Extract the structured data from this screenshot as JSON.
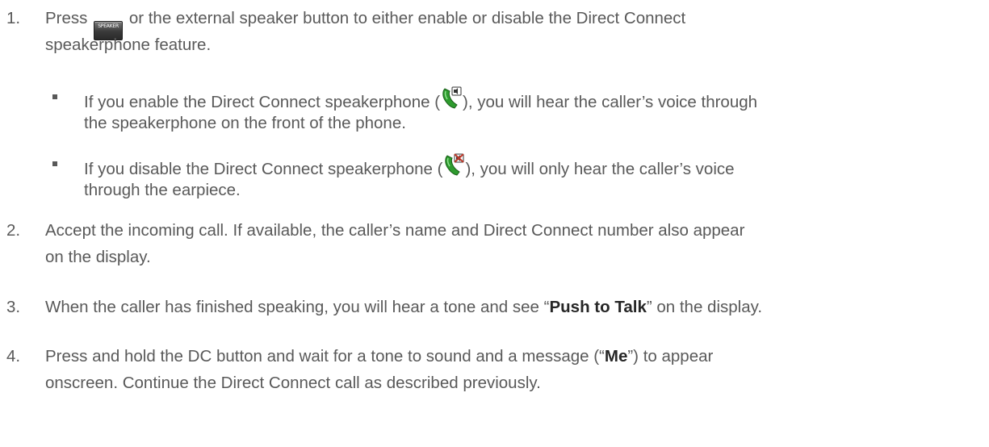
{
  "steps": [
    {
      "number": "1.",
      "press": "Press",
      "key_label": "SPEAKER",
      "line1_rest": "or the external speaker button to either enable or disable the Direct Connect",
      "line2": "speakerphone feature.",
      "bullets": [
        {
          "line1_before": "If you enable the Direct Connect speakerphone (",
          "icon": "dc-speaker-on-icon",
          "line1_after": "), you will hear the caller’s voice through",
          "line2": "the speakerphone on the front of the phone."
        },
        {
          "line1_before": "If you disable the Direct Connect speakerphone (",
          "icon": "dc-speaker-off-icon",
          "line1_after": "), you will only hear the caller’s voice",
          "line2": "through the earpiece."
        }
      ]
    },
    {
      "number": "2.",
      "line1": "Accept the incoming call. If available, the caller’s name and Direct Connect number also appear",
      "line2": "on the display."
    },
    {
      "number": "3.",
      "line1_before": "When the caller has finished speaking, you will hear a tone and see “",
      "bold": "Push to Talk",
      "line1_after": "” on the display."
    },
    {
      "number": "4.",
      "line1_before": "Press and hold the DC button and wait for a tone to sound and a message (“",
      "bold": "Me",
      "line1_after": "”) to appear",
      "line2": "onscreen. Continue the Direct Connect call as described previously."
    }
  ],
  "colors": {
    "text": "#595959",
    "bold_text": "#262626",
    "icon_green": "#2e9b2e",
    "icon_red": "#c0392b"
  }
}
